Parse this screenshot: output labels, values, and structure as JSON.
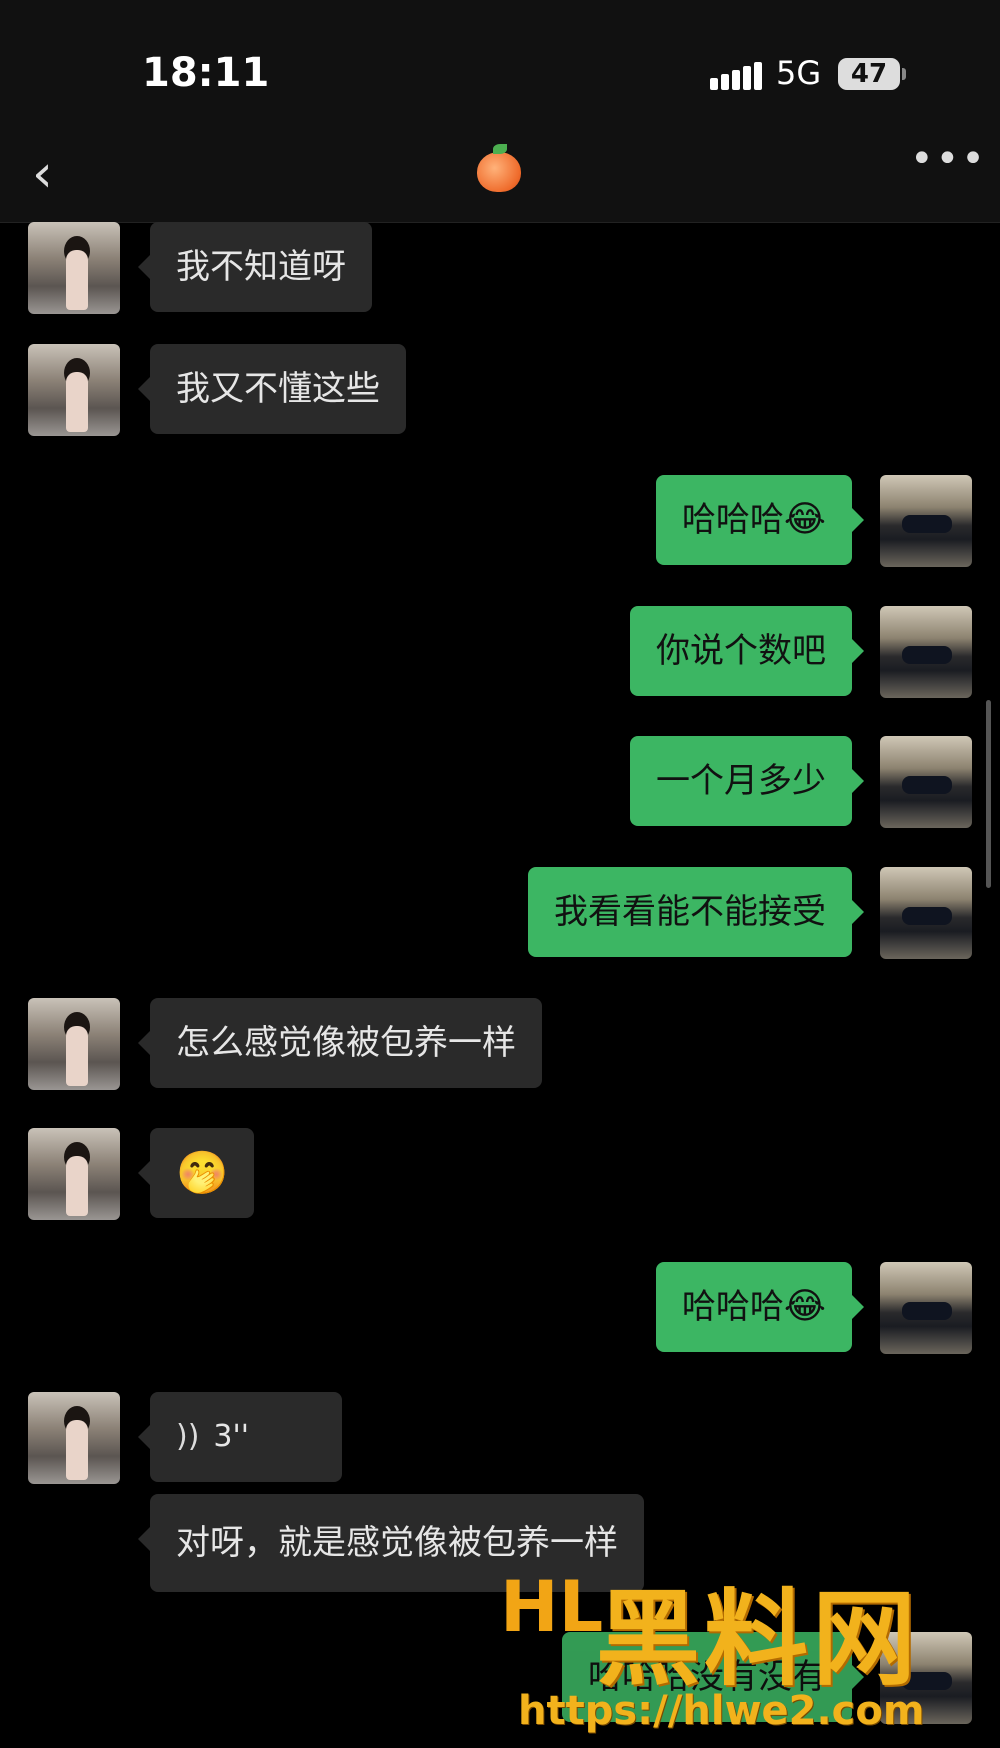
{
  "status_bar": {
    "time": "18:11",
    "network": "5G",
    "battery": "47"
  },
  "nav": {
    "back_icon": "chevron-left-icon",
    "contact_icon": "peach-emoji",
    "more_icon": "more-dots-icon"
  },
  "messages": [
    {
      "from": "her",
      "text": "我不知道呀"
    },
    {
      "from": "her",
      "text": "我又不懂这些"
    },
    {
      "from": "me",
      "text": "哈哈哈",
      "emoji": "😂"
    },
    {
      "from": "me",
      "text": "你说个数吧"
    },
    {
      "from": "me",
      "text": "一个月多少"
    },
    {
      "from": "me",
      "text": "我看看能不能接受"
    },
    {
      "from": "her",
      "text": "怎么感觉像被包养一样"
    },
    {
      "from": "her",
      "emoji": "🤭"
    },
    {
      "from": "me",
      "text": "哈哈哈",
      "emoji": "😂"
    },
    {
      "from": "her",
      "voice_duration": "3''"
    },
    {
      "from": "her",
      "text": "对呀，就是感觉像被包养一样"
    },
    {
      "from": "me",
      "text": "哈哈哈没有没有"
    }
  ],
  "watermark": {
    "title": "黑料网",
    "url": "https://hlwe2.com",
    "logo": "HL"
  },
  "colors": {
    "sent_bubble": "#3cb663",
    "received_bubble": "#2a2a2a",
    "background": "#000000",
    "watermark": "#f2b21c"
  }
}
